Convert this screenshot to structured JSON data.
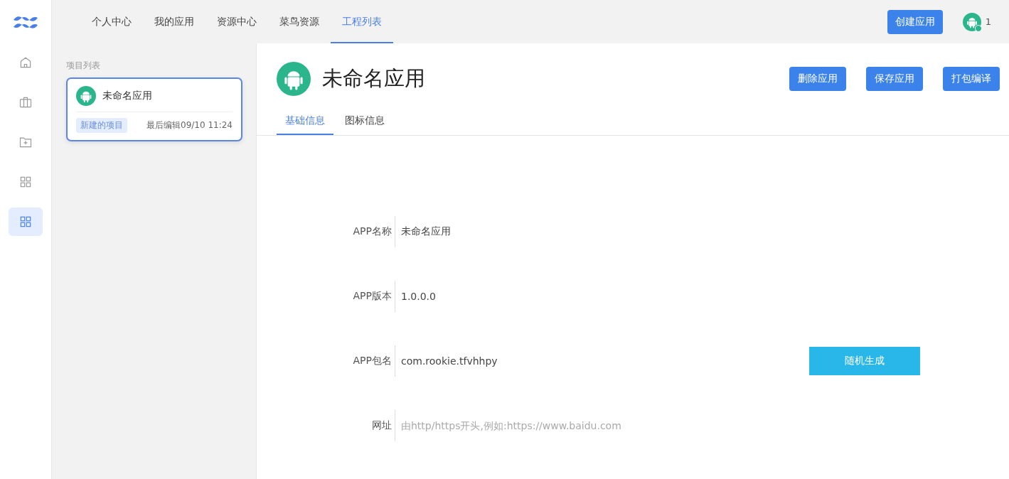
{
  "sidebar": {
    "items": [
      {
        "kind": "home",
        "selected": false
      },
      {
        "kind": "briefcase",
        "selected": false
      },
      {
        "kind": "folder-add",
        "selected": false
      },
      {
        "kind": "grid",
        "selected": false
      },
      {
        "kind": "grid",
        "selected": true
      }
    ]
  },
  "nav": {
    "items": [
      {
        "label": "个人中心",
        "selected": false
      },
      {
        "label": "我的应用",
        "selected": false
      },
      {
        "label": "资源中心",
        "selected": false
      },
      {
        "label": "菜鸟资源",
        "selected": false
      },
      {
        "label": "工程列表",
        "selected": true
      }
    ],
    "create_button": "创建应用",
    "user_count": "1"
  },
  "project_list": {
    "title": "项目列表",
    "items": [
      {
        "name": "未命名应用",
        "tag": "新建的项目",
        "edited": "最后编辑09/10 11:24",
        "selected": true
      }
    ]
  },
  "app": {
    "title": "未命名应用",
    "buttons": [
      "删除应用",
      "保存应用",
      "打包编译"
    ],
    "tabs": [
      {
        "label": "基础信息",
        "selected": true
      },
      {
        "label": "图标信息",
        "selected": false
      }
    ],
    "fields": [
      {
        "label": "APP名称",
        "value": "未命名应用"
      },
      {
        "label": "APP版本",
        "value": "1.0.0.0"
      },
      {
        "label": "APP包名",
        "value": "com.rookie.tfvhhpy",
        "action": "随机生成"
      },
      {
        "label": "网址",
        "placeholder": "由http/https开头,例如:https://www.baidu.com"
      }
    ]
  }
}
